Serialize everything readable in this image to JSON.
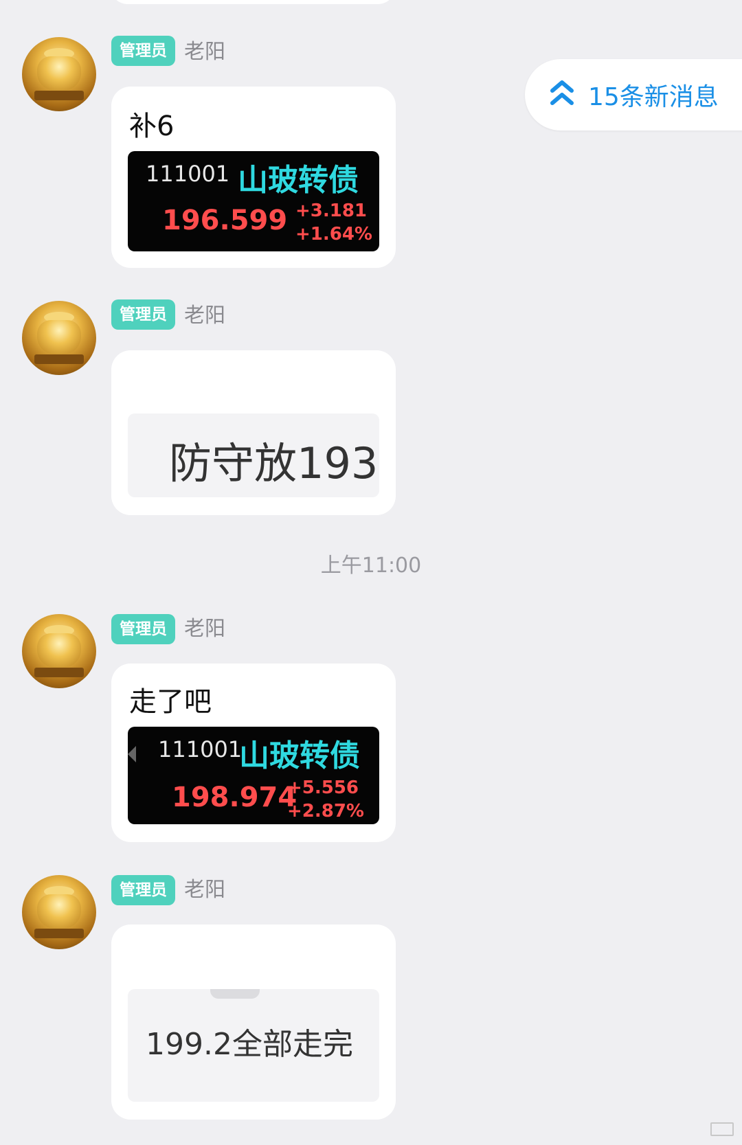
{
  "new_messages": {
    "label": "15条新消息"
  },
  "timestamp": "上午11:00",
  "messages": [
    {
      "role_badge": "管理员",
      "sender": "老阳",
      "text": "补6",
      "quote": {
        "code": "111001",
        "name": "山玻转债",
        "price": "196.599",
        "change": "+3.181",
        "change_pct": "+1.64%"
      }
    },
    {
      "role_badge": "管理员",
      "sender": "老阳",
      "image_text": "防守放193"
    },
    {
      "role_badge": "管理员",
      "sender": "老阳",
      "text": "走了吧",
      "quote": {
        "code": "111001",
        "name": "山玻转债",
        "price": "198.974",
        "change": "+5.556",
        "change_pct": "+2.87%"
      }
    },
    {
      "role_badge": "管理员",
      "sender": "老阳",
      "image_text": "199.2全部走完"
    }
  ],
  "colors": {
    "background": "#efeff2",
    "badge": "#4fd1bd",
    "accent_blue": "#1a8fe6",
    "quote_name": "#2fd9e0",
    "quote_up": "#ff4d4d"
  }
}
